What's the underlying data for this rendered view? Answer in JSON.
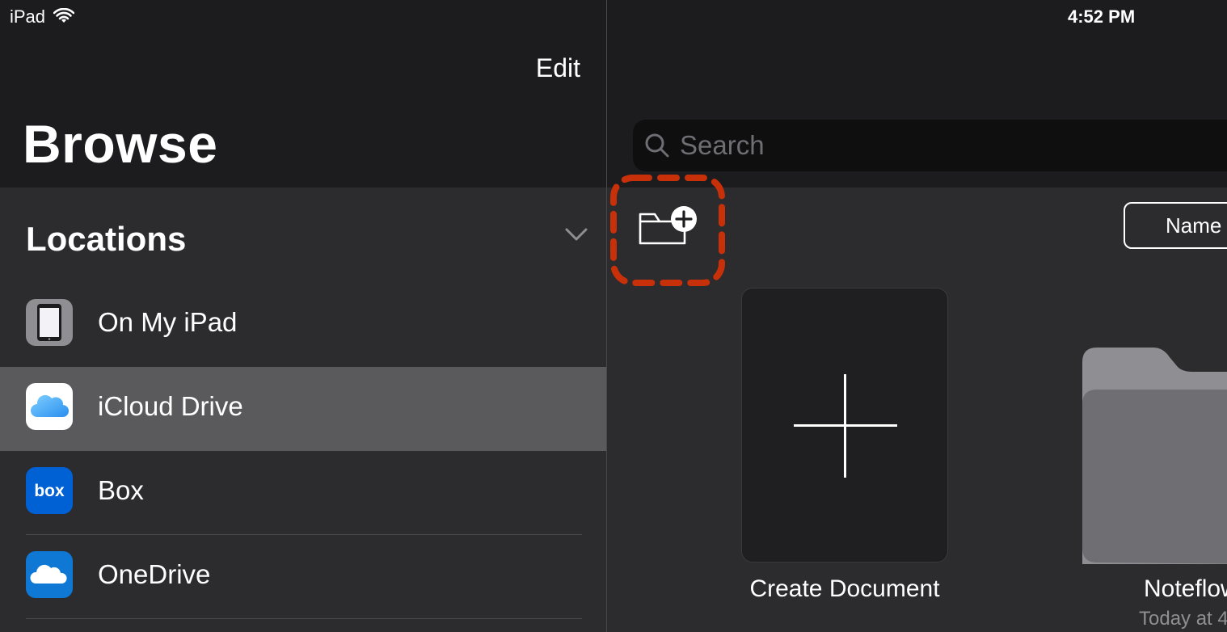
{
  "status_bar": {
    "device": "iPad",
    "time": "4:52 PM"
  },
  "sidebar": {
    "edit_label": "Edit",
    "title": "Browse",
    "section_title": "Locations",
    "items": [
      {
        "label": "On My iPad",
        "icon": "ipad-icon"
      },
      {
        "label": "iCloud Drive",
        "icon": "icloud-icon",
        "selected": true
      },
      {
        "label": "Box",
        "icon": "box-icon",
        "icon_text": "box"
      },
      {
        "label": "OneDrive",
        "icon": "onedrive-icon"
      }
    ]
  },
  "main": {
    "search": {
      "placeholder": "Search"
    },
    "sort_label": "Name",
    "create_document_label": "Create Document",
    "folder": {
      "name": "Noteflow",
      "subtitle": "Today at 4"
    },
    "highlight_color": "#c8300a"
  }
}
